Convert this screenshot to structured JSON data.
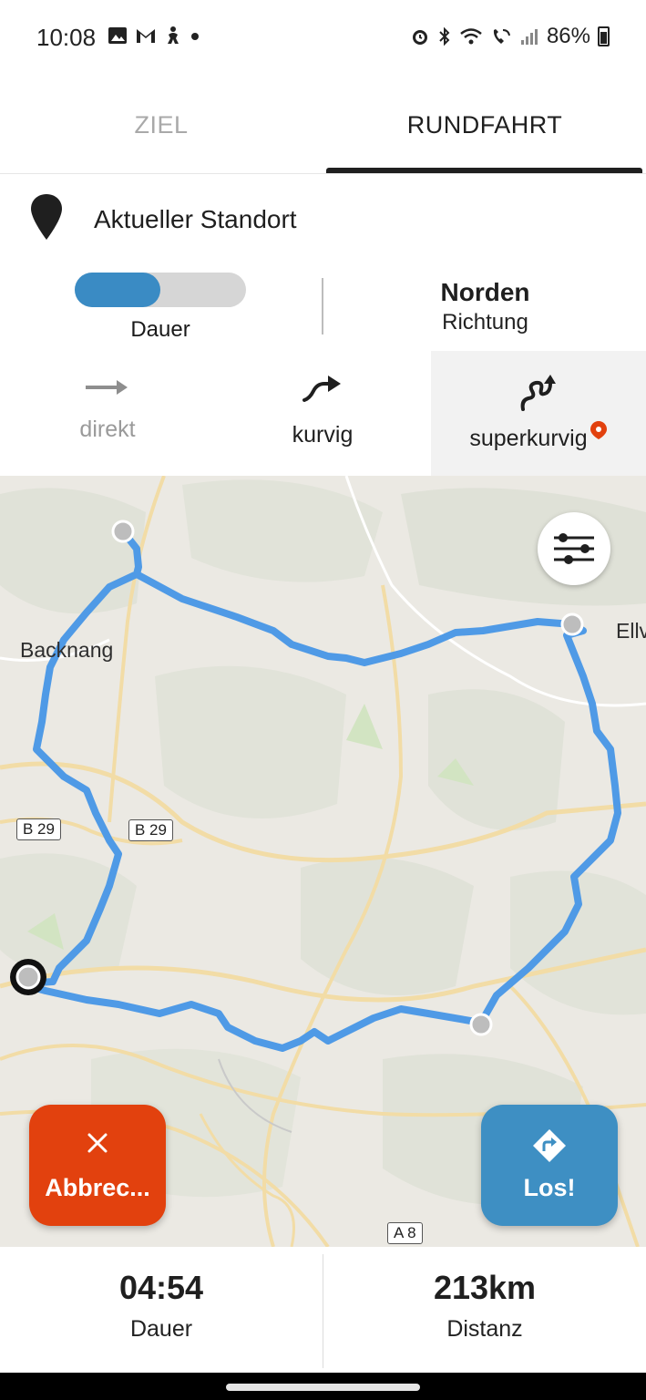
{
  "status_bar": {
    "time": "10:08",
    "battery": "86%",
    "left_icons": [
      "gallery-icon",
      "gmail-icon",
      "bicycle-icon",
      "dot-icon"
    ],
    "right_icons": [
      "alarm-icon",
      "bluetooth-icon",
      "wifi-icon",
      "wifi-call-icon",
      "signal-icon",
      "battery-icon"
    ]
  },
  "tabs": [
    {
      "label": "ZIEL",
      "active": false
    },
    {
      "label": "RUNDFAHRT",
      "active": true
    }
  ],
  "location": {
    "label": "Aktueller Standort",
    "icon": "location-pin-icon"
  },
  "duration_slider": {
    "label": "Dauer",
    "level": 0.5,
    "fill_color": "#3a8bc4"
  },
  "direction": {
    "value": "Norden",
    "label": "Richtung"
  },
  "route_styles": [
    {
      "label": "direkt",
      "icon": "arrow-right-icon",
      "selected": false
    },
    {
      "label": "kurvig",
      "icon": "curvy-arrow-icon",
      "selected": false
    },
    {
      "label": "superkurvig",
      "icon": "super-curvy-icon",
      "selected": true,
      "badge": "premium-pin-icon"
    }
  ],
  "map": {
    "labels": {
      "town1": "Backnang",
      "town2": "Ellv"
    },
    "road_badges": [
      "B 29",
      "B 29",
      "A 8"
    ],
    "route_color": "#4f9ae6"
  },
  "actions": {
    "cancel_label": "Abbrec...",
    "go_label": "Los!",
    "cancel_color": "#e2410e",
    "go_color": "#3e8fc3"
  },
  "stats": {
    "duration_value": "04:54",
    "duration_label": "Dauer",
    "distance_value": "213km",
    "distance_label": "Distanz"
  }
}
